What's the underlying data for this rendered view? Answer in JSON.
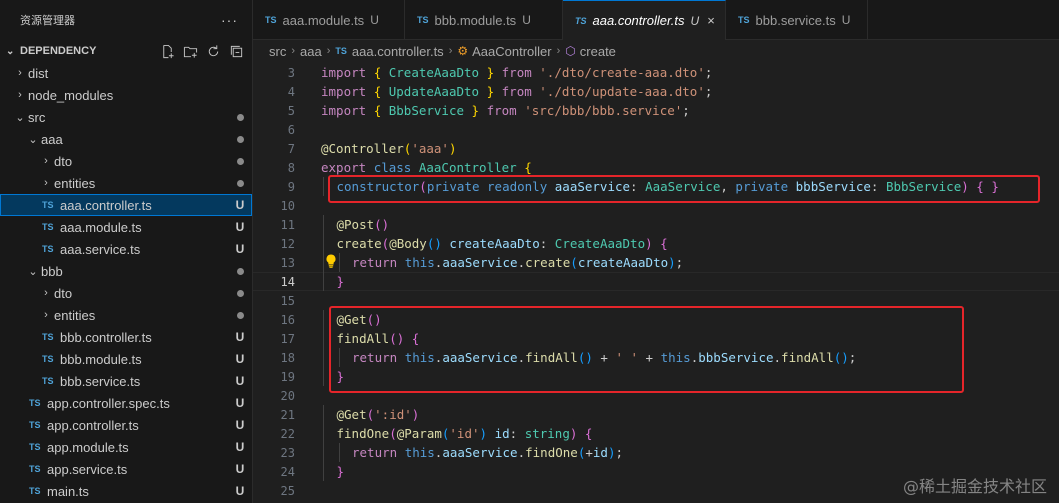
{
  "explorer": {
    "title": "资源管理器",
    "more_label": "···",
    "section_title": "DEPENDENCY",
    "items": [
      {
        "label": "dist",
        "kind": "folder",
        "depth": 1,
        "open": false,
        "status": ""
      },
      {
        "label": "node_modules",
        "kind": "folder",
        "depth": 1,
        "open": false,
        "status": ""
      },
      {
        "label": "src",
        "kind": "folder",
        "depth": 1,
        "open": true,
        "status": "dot"
      },
      {
        "label": "aaa",
        "kind": "folder",
        "depth": 2,
        "open": true,
        "status": "dot"
      },
      {
        "label": "dto",
        "kind": "folder",
        "depth": 3,
        "open": false,
        "status": "dot"
      },
      {
        "label": "entities",
        "kind": "folder",
        "depth": 3,
        "open": false,
        "status": "dot"
      },
      {
        "label": "aaa.controller.ts",
        "kind": "ts",
        "depth": 3,
        "status": "U",
        "selected": true
      },
      {
        "label": "aaa.module.ts",
        "kind": "ts",
        "depth": 3,
        "status": "U"
      },
      {
        "label": "aaa.service.ts",
        "kind": "ts",
        "depth": 3,
        "status": "U"
      },
      {
        "label": "bbb",
        "kind": "folder",
        "depth": 2,
        "open": true,
        "status": "dot"
      },
      {
        "label": "dto",
        "kind": "folder",
        "depth": 3,
        "open": false,
        "status": "dot"
      },
      {
        "label": "entities",
        "kind": "folder",
        "depth": 3,
        "open": false,
        "status": "dot"
      },
      {
        "label": "bbb.controller.ts",
        "kind": "ts",
        "depth": 3,
        "status": "U"
      },
      {
        "label": "bbb.module.ts",
        "kind": "ts",
        "depth": 3,
        "status": "U"
      },
      {
        "label": "bbb.service.ts",
        "kind": "ts",
        "depth": 3,
        "status": "U"
      },
      {
        "label": "app.controller.spec.ts",
        "kind": "ts",
        "depth": 2,
        "status": "U"
      },
      {
        "label": "app.controller.ts",
        "kind": "ts",
        "depth": 2,
        "status": "U"
      },
      {
        "label": "app.module.ts",
        "kind": "ts",
        "depth": 2,
        "status": "U"
      },
      {
        "label": "app.service.ts",
        "kind": "ts",
        "depth": 2,
        "status": "U"
      },
      {
        "label": "main.ts",
        "kind": "ts",
        "depth": 2,
        "status": "U"
      }
    ]
  },
  "tabs": [
    {
      "icon": "TS",
      "label": "aaa.module.ts",
      "status": "U"
    },
    {
      "icon": "TS",
      "label": "bbb.module.ts",
      "status": "U"
    },
    {
      "icon": "TS",
      "label": "aaa.controller.ts",
      "status": "U",
      "active": true,
      "close": "×"
    },
    {
      "icon": "TS",
      "label": "bbb.service.ts",
      "status": "U"
    }
  ],
  "breadcrumb": {
    "parts": [
      "src",
      "aaa",
      "aaa.controller.ts",
      "AaaController",
      "create"
    ],
    "ts_icon": "TS"
  },
  "editor": {
    "current_line": 14,
    "lines": [
      {
        "n": 3,
        "indent": 0,
        "tokens": [
          [
            "k",
            "import "
          ],
          [
            "p1",
            "{ "
          ],
          [
            "t",
            "CreateAaaDto"
          ],
          [
            "p1",
            " }"
          ],
          [
            "k",
            " from "
          ],
          [
            "s",
            "'./dto/create-aaa.dto'"
          ],
          [
            "",
            "; "
          ]
        ]
      },
      {
        "n": 4,
        "indent": 0,
        "tokens": [
          [
            "k",
            "import "
          ],
          [
            "p1",
            "{ "
          ],
          [
            "t",
            "UpdateAaaDto"
          ],
          [
            "p1",
            " }"
          ],
          [
            "k",
            " from "
          ],
          [
            "s",
            "'./dto/update-aaa.dto'"
          ],
          [
            "",
            ";"
          ]
        ]
      },
      {
        "n": 5,
        "indent": 0,
        "tokens": [
          [
            "k",
            "import "
          ],
          [
            "p1",
            "{ "
          ],
          [
            "t",
            "BbbService"
          ],
          [
            "p1",
            " }"
          ],
          [
            "k",
            " from "
          ],
          [
            "s",
            "'src/bbb/bbb.service'"
          ],
          [
            "",
            ";"
          ]
        ]
      },
      {
        "n": 6,
        "indent": 0,
        "tokens": []
      },
      {
        "n": 7,
        "indent": 0,
        "tokens": [
          [
            "f",
            "@Controller"
          ],
          [
            "p1",
            "("
          ],
          [
            "s",
            "'aaa'"
          ],
          [
            "p1",
            ")"
          ]
        ]
      },
      {
        "n": 8,
        "indent": 0,
        "tokens": [
          [
            "k",
            "export "
          ],
          [
            "b",
            "class "
          ],
          [
            "t",
            "AaaController "
          ],
          [
            "p1",
            "{"
          ]
        ]
      },
      {
        "n": 9,
        "indent": 1,
        "tokens": [
          [
            "b",
            "constructor"
          ],
          [
            "p2",
            "("
          ],
          [
            "b",
            "private readonly "
          ],
          [
            "v",
            "aaaService"
          ],
          [
            "",
            ": "
          ],
          [
            "t",
            "AaaService"
          ],
          [
            "",
            ", "
          ],
          [
            "b",
            "private "
          ],
          [
            "v",
            "bbbService"
          ],
          [
            "",
            ": "
          ],
          [
            "t",
            "BbbService"
          ],
          [
            "p2",
            ")"
          ],
          [
            "p2",
            " { }"
          ]
        ]
      },
      {
        "n": 10,
        "indent": 0,
        "tokens": []
      },
      {
        "n": 11,
        "indent": 1,
        "tokens": [
          [
            "f",
            "@Post"
          ],
          [
            "p2",
            "()"
          ]
        ]
      },
      {
        "n": 12,
        "indent": 1,
        "tokens": [
          [
            "f",
            "create"
          ],
          [
            "p2",
            "("
          ],
          [
            "f",
            "@Body"
          ],
          [
            "p3",
            "()"
          ],
          [
            "v",
            " createAaaDto"
          ],
          [
            "",
            ": "
          ],
          [
            "t",
            "CreateAaaDto"
          ],
          [
            "p2",
            ")"
          ],
          [
            "p2",
            " {"
          ]
        ]
      },
      {
        "n": 13,
        "indent": 2,
        "tokens": [
          [
            "k",
            "return "
          ],
          [
            "b",
            "this"
          ],
          [
            "",
            "."
          ],
          [
            "v",
            "aaaService"
          ],
          [
            "",
            "."
          ],
          [
            "f",
            "create"
          ],
          [
            "p3",
            "("
          ],
          [
            "v",
            "createAaaDto"
          ],
          [
            "p3",
            ")"
          ],
          [
            "",
            ";"
          ]
        ]
      },
      {
        "n": 14,
        "indent": 1,
        "tokens": [
          [
            "p2",
            "}"
          ]
        ]
      },
      {
        "n": 15,
        "indent": 0,
        "tokens": []
      },
      {
        "n": 16,
        "indent": 1,
        "tokens": [
          [
            "f",
            "@Get"
          ],
          [
            "p2",
            "()"
          ]
        ]
      },
      {
        "n": 17,
        "indent": 1,
        "tokens": [
          [
            "f",
            "findAll"
          ],
          [
            "p2",
            "()"
          ],
          [
            "p2",
            " {"
          ]
        ]
      },
      {
        "n": 18,
        "indent": 2,
        "tokens": [
          [
            "k",
            "return "
          ],
          [
            "b",
            "this"
          ],
          [
            "",
            "."
          ],
          [
            "v",
            "aaaService"
          ],
          [
            "",
            "."
          ],
          [
            "f",
            "findAll"
          ],
          [
            "p3",
            "()"
          ],
          [
            "",
            " + "
          ],
          [
            "s",
            "' '"
          ],
          [
            "",
            " + "
          ],
          [
            "b",
            "this"
          ],
          [
            "",
            "."
          ],
          [
            "v",
            "bbbService"
          ],
          [
            "",
            "."
          ],
          [
            "f",
            "findAll"
          ],
          [
            "p3",
            "()"
          ],
          [
            "",
            ";"
          ]
        ]
      },
      {
        "n": 19,
        "indent": 1,
        "tokens": [
          [
            "p2",
            "}"
          ]
        ]
      },
      {
        "n": 20,
        "indent": 0,
        "tokens": []
      },
      {
        "n": 21,
        "indent": 1,
        "tokens": [
          [
            "f",
            "@Get"
          ],
          [
            "p2",
            "("
          ],
          [
            "s",
            "':id'"
          ],
          [
            "p2",
            ")"
          ]
        ]
      },
      {
        "n": 22,
        "indent": 1,
        "tokens": [
          [
            "f",
            "findOne"
          ],
          [
            "p2",
            "("
          ],
          [
            "f",
            "@Param"
          ],
          [
            "p3",
            "("
          ],
          [
            "s",
            "'id'"
          ],
          [
            "p3",
            ")"
          ],
          [
            "v",
            " id"
          ],
          [
            "",
            ": "
          ],
          [
            "t",
            "string"
          ],
          [
            "p2",
            ")"
          ],
          [
            "p2",
            " {"
          ]
        ]
      },
      {
        "n": 23,
        "indent": 2,
        "tokens": [
          [
            "k",
            "return "
          ],
          [
            "b",
            "this"
          ],
          [
            "",
            "."
          ],
          [
            "v",
            "aaaService"
          ],
          [
            "",
            "."
          ],
          [
            "f",
            "findOne"
          ],
          [
            "p3",
            "("
          ],
          [
            "",
            "+"
          ],
          [
            "v",
            "id"
          ],
          [
            "p3",
            ")"
          ],
          [
            "",
            ";"
          ]
        ]
      },
      {
        "n": 24,
        "indent": 1,
        "tokens": [
          [
            "p2",
            "}"
          ]
        ]
      },
      {
        "n": 25,
        "indent": 0,
        "tokens": []
      }
    ]
  },
  "watermark": "@稀土掘金技术社区"
}
